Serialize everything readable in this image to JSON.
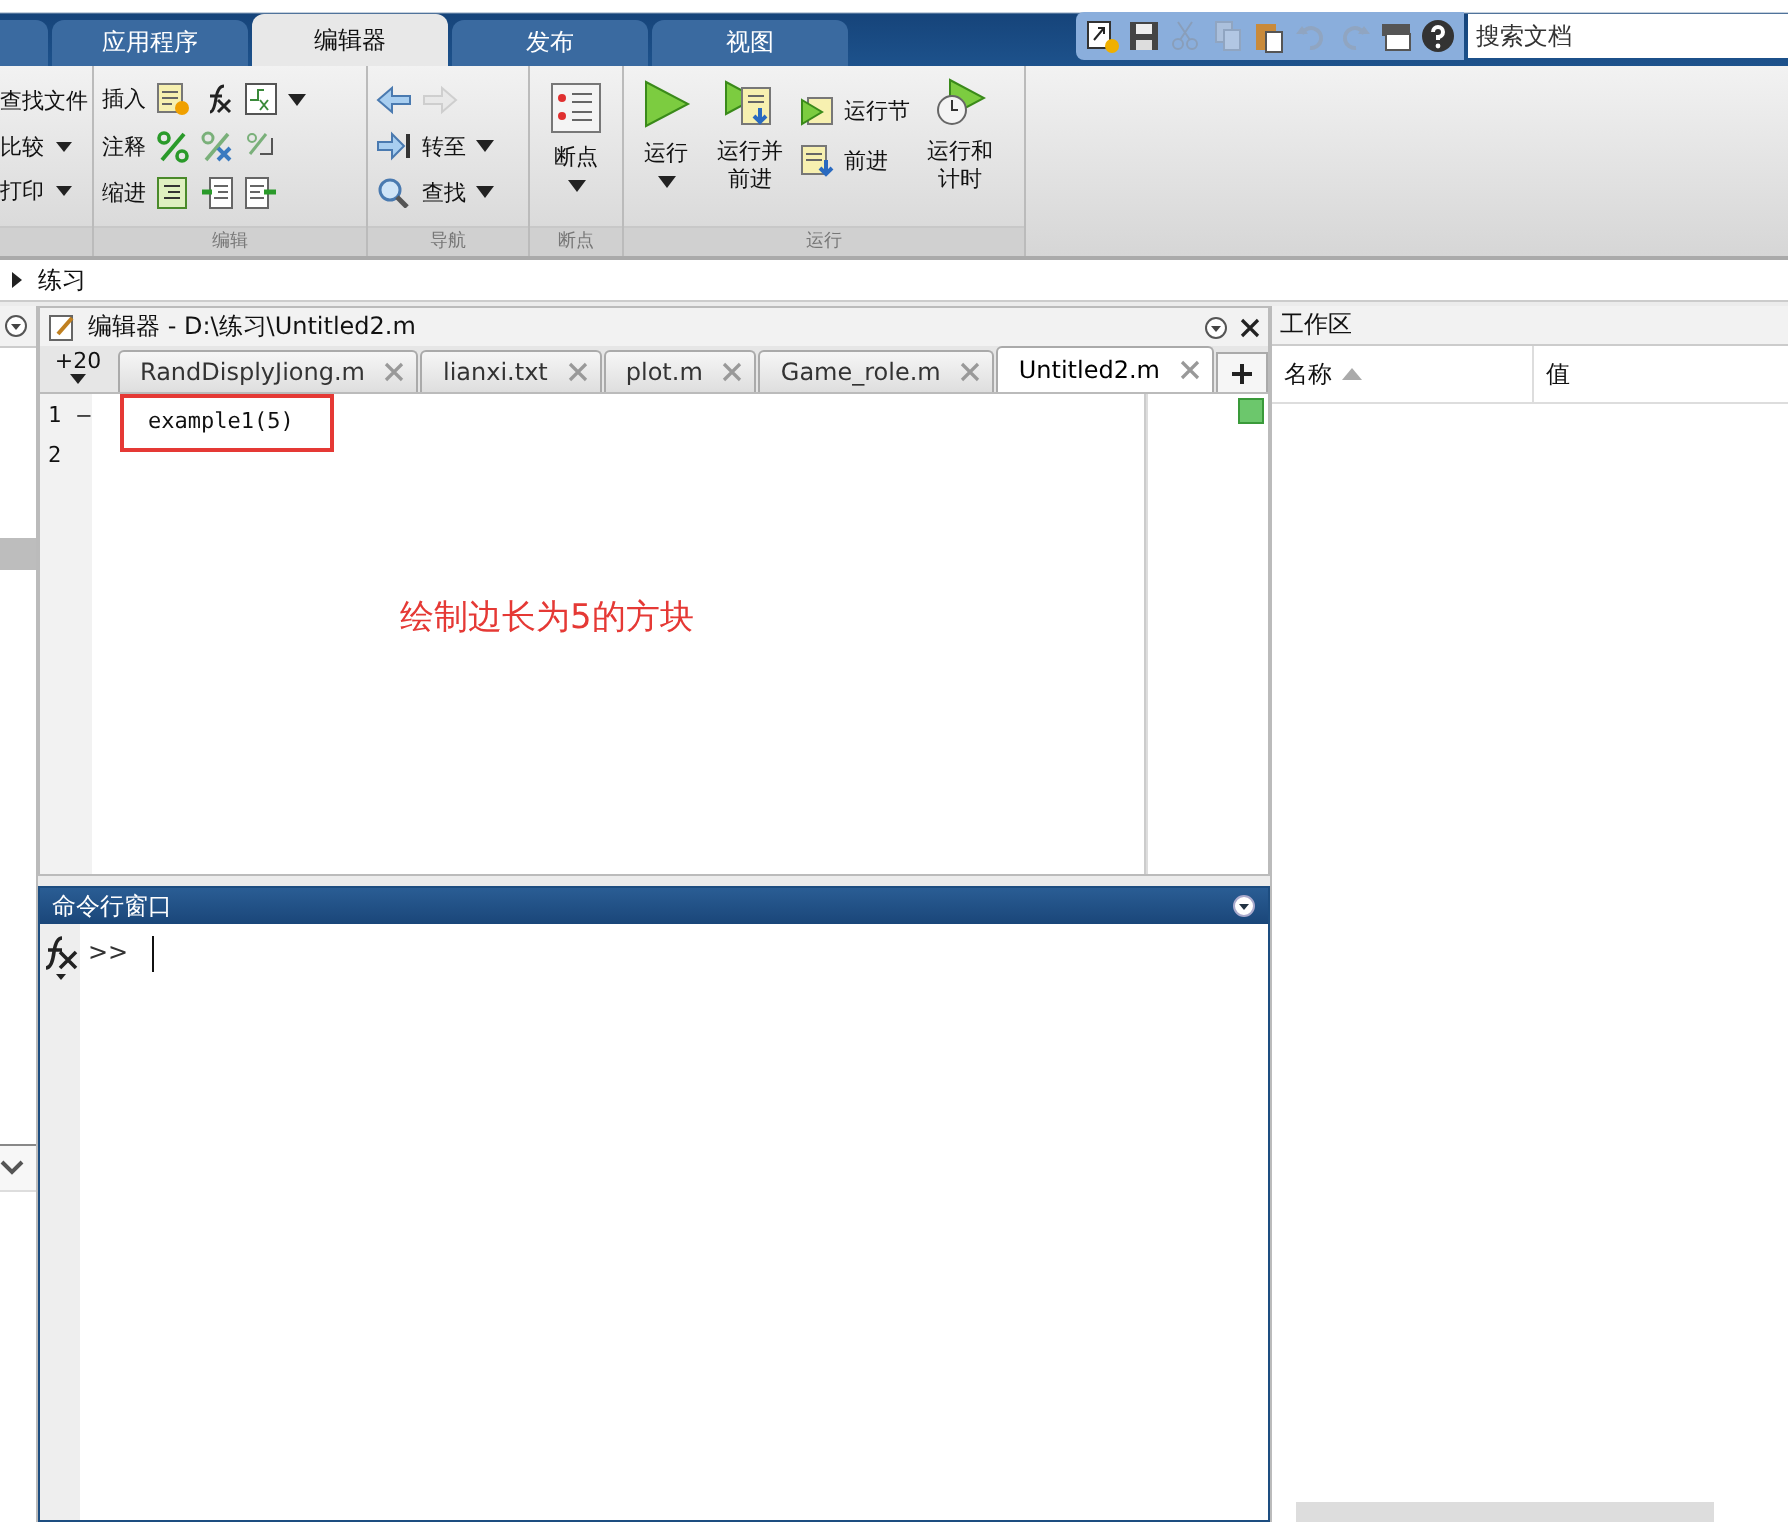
{
  "app_tabs": [
    {
      "label": "应用程序",
      "selected": false
    },
    {
      "label": "编辑器",
      "selected": true
    },
    {
      "label": "发布",
      "selected": false
    },
    {
      "label": "视图",
      "selected": false
    }
  ],
  "quick_access": [
    {
      "kind": "new",
      "disabled": false
    },
    {
      "kind": "save",
      "disabled": false
    },
    {
      "kind": "cut",
      "disabled": true
    },
    {
      "kind": "copy",
      "disabled": true
    },
    {
      "kind": "paste",
      "disabled": false
    },
    {
      "kind": "undo",
      "disabled": true
    },
    {
      "kind": "redo",
      "disabled": true
    },
    {
      "kind": "windows",
      "disabled": false
    },
    {
      "kind": "help",
      "disabled": false
    }
  ],
  "search": {
    "placeholder": "搜索文档"
  },
  "ribbon": {
    "file_items": [
      {
        "label": "查找文件",
        "dropdown": false
      },
      {
        "label": "比较",
        "dropdown": true
      },
      {
        "label": "打印",
        "dropdown": true
      }
    ],
    "groups": [
      {
        "kind": "edit",
        "title": "编辑",
        "rows": [
          "插入",
          "注释",
          "缩进"
        ]
      },
      {
        "kind": "nav",
        "title": "导航",
        "items": [
          "转至",
          "查找"
        ]
      },
      {
        "kind": "breakpoint",
        "title": "断点",
        "items": [
          "断点"
        ]
      },
      {
        "kind": "run",
        "title": "运行",
        "items": [
          "运行",
          "运行并前进",
          "运行节",
          "前进",
          "运行和计时"
        ]
      }
    ]
  },
  "address": {
    "folder": "练习"
  },
  "editor": {
    "title": "编辑器 - D:\\练习\\Untitled2.m",
    "zoom": "+20",
    "tabs": [
      {
        "label": "RandDisplyJiong.m",
        "selected": false
      },
      {
        "label": "lianxi.txt",
        "selected": false
      },
      {
        "label": "plot.m",
        "selected": false
      },
      {
        "label": "Game_role.m",
        "selected": false
      },
      {
        "label": "Untitled2.m",
        "selected": true
      }
    ],
    "lines": [
      {
        "number": "1",
        "marker": "–",
        "code": "example1(5)",
        "highlighted": true
      },
      {
        "number": "2",
        "highlighted": false
      }
    ],
    "annotation": "绘制边长为5的方块"
  },
  "command_window": {
    "title": "命令行窗口",
    "prompt": ">>"
  },
  "workspace": {
    "title": "工作区",
    "columns": [
      {
        "label": "名称",
        "sorted": true
      },
      {
        "label": "值",
        "sorted": false
      }
    ]
  }
}
